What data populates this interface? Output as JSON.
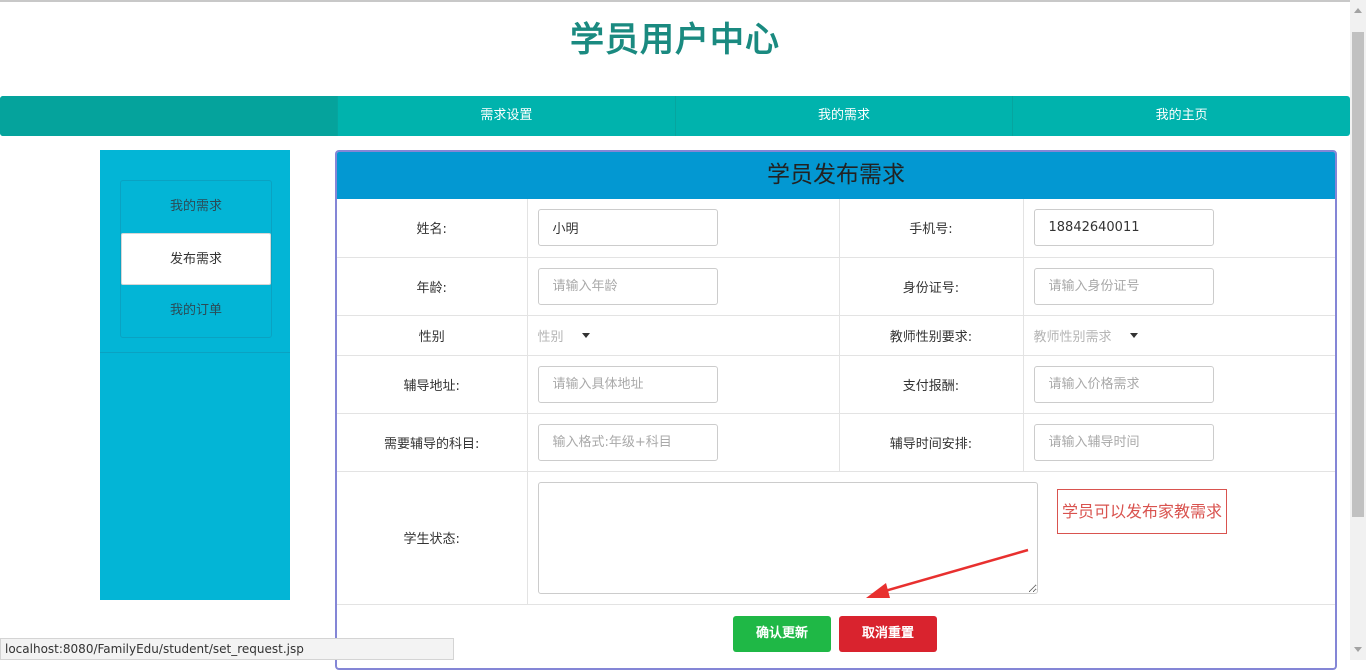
{
  "page": {
    "title": "学员用户中心"
  },
  "nav": {
    "items": [
      "需求设置",
      "我的需求",
      "我的主页"
    ]
  },
  "sidebar": {
    "items": [
      "我的需求",
      "发布需求",
      "我的订单"
    ],
    "active_index": 1
  },
  "form": {
    "title": "学员发布需求",
    "name_label": "姓名:",
    "name_value": "小明",
    "phone_label": "手机号:",
    "phone_value": "18842640011",
    "age_label": "年龄:",
    "age_placeholder": "请输入年龄",
    "id_label": "身份证号:",
    "id_placeholder": "请输入身份证号",
    "gender_label": "性别",
    "gender_value": "性别",
    "teacher_gender_label": "教师性别要求:",
    "teacher_gender_value": "教师性别需求",
    "address_label": "辅导地址:",
    "address_placeholder": "请输入具体地址",
    "pay_label": "支付报酬:",
    "pay_placeholder": "请输入价格需求",
    "subject_label": "需要辅导的科目:",
    "subject_placeholder": "输入格式:年级+科目",
    "time_label": "辅导时间安排:",
    "time_placeholder": "请输入辅导时间",
    "status_label": "学生状态:",
    "status_value": ""
  },
  "annotation": {
    "text": "学员可以发布家教需求",
    "color": "#d9534f"
  },
  "buttons": {
    "confirm": "确认更新",
    "reset": "取消重置"
  },
  "statusbar": {
    "url": "localhost:8080/FamilyEdu/student/set_request.jsp"
  },
  "colors": {
    "nav": "#00b3ad",
    "sidebar": "#03b5d6",
    "panel_header": "#0398d2",
    "title": "#1a8a80"
  },
  "icons": {
    "select_caret": "caret-down-icon",
    "arrow": "arrow-icon"
  }
}
